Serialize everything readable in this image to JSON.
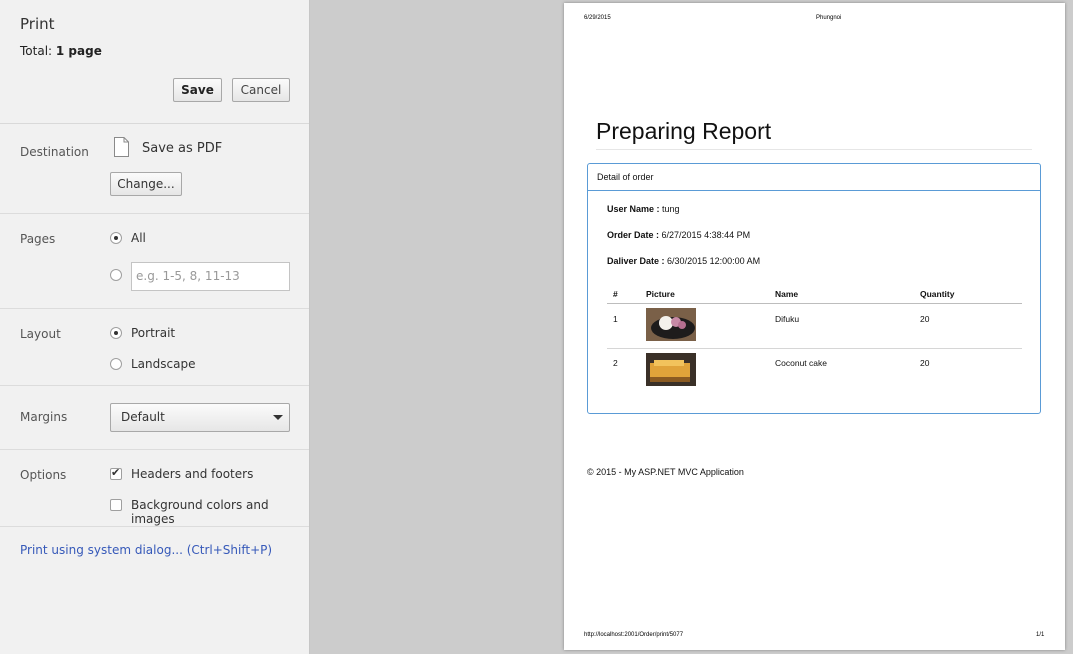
{
  "panel": {
    "title": "Print",
    "total_label": "Total:",
    "total_value": "1 page",
    "save_label": "Save",
    "cancel_label": "Cancel",
    "destination": {
      "label": "Destination",
      "value": "Save as PDF",
      "change_label": "Change..."
    },
    "pages": {
      "label": "Pages",
      "all_label": "All",
      "range_placeholder": "e.g. 1-5, 8, 11-13",
      "selected": "All"
    },
    "layout": {
      "label": "Layout",
      "portrait_label": "Portrait",
      "landscape_label": "Landscape",
      "selected": "Portrait"
    },
    "margins": {
      "label": "Margins",
      "value": "Default"
    },
    "options": {
      "label": "Options",
      "headers_footers_label": "Headers and footers",
      "headers_footers_checked": true,
      "background_label": "Background colors and images",
      "background_checked": false
    },
    "system_dialog_label": "Print using system dialog... (Ctrl+Shift+P)"
  },
  "preview": {
    "header_date": "6/29/2015",
    "header_title": "Phungnoi",
    "report_title": "Preparing Report",
    "panel_heading": "Detail of order",
    "user_name_label": "User Name :",
    "user_name_value": "tung",
    "order_date_label": "Order Date :",
    "order_date_value": "6/27/2015 4:38:44 PM",
    "deliver_date_label": "Daliver Date :",
    "deliver_date_value": "6/30/2015 12:00:00 AM",
    "table": {
      "headers": [
        "#",
        "Picture",
        "Name",
        "Quantity"
      ],
      "rows": [
        {
          "num": "1",
          "name": "Difuku",
          "quantity": "20"
        },
        {
          "num": "2",
          "name": "Coconut cake",
          "quantity": "20"
        }
      ]
    },
    "footer_copyright": "© 2015 - My ASP.NET MVC Application",
    "footer_url": "http://localhost:2001/Order/print/5077",
    "footer_page": "1/1"
  }
}
